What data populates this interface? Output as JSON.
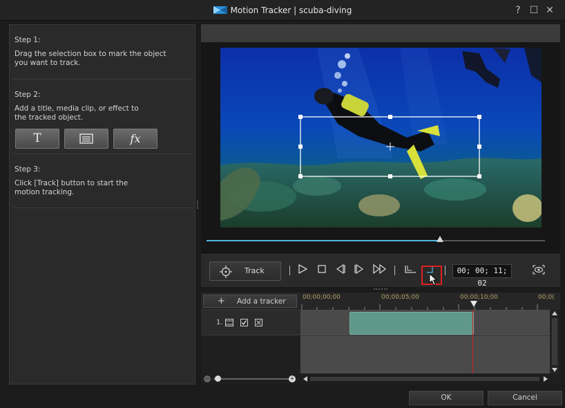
{
  "window": {
    "title": "Motion Tracker  |  scuba-diving",
    "help_glyph": "?",
    "maximize_glyph": "☐",
    "close_glyph": "✕"
  },
  "steps": {
    "step1": {
      "title": "Step 1:",
      "text": "Drag the selection box to mark the object you want to track."
    },
    "step2": {
      "title": "Step 2:",
      "text": "Add a title, media clip, or effect to the tracked object.",
      "buttons": [
        {
          "label": "T",
          "icon": "title-icon"
        },
        {
          "label": "",
          "icon": "media-clip-icon"
        },
        {
          "label": "fx",
          "icon": "effect-icon"
        }
      ]
    },
    "step3": {
      "title": "Step 3:",
      "text": "Click [Track] button to start the motion tracking."
    }
  },
  "playback": {
    "track_label": "Track",
    "timecode": "00; 00; 11; 02",
    "position_fraction": 0.69
  },
  "timeline": {
    "add_tracker_label": "Add a tracker",
    "ruler_labels": [
      "00;00;00;00",
      "00;00;05;00",
      "00;00;10;00",
      "00;0("
    ],
    "track_index": "1."
  },
  "footer": {
    "ok_label": "OK",
    "cancel_label": "Cancel"
  },
  "colors": {
    "accent": "#4fb6e3",
    "highlight": "#e02020",
    "clip": "#5f978a"
  }
}
